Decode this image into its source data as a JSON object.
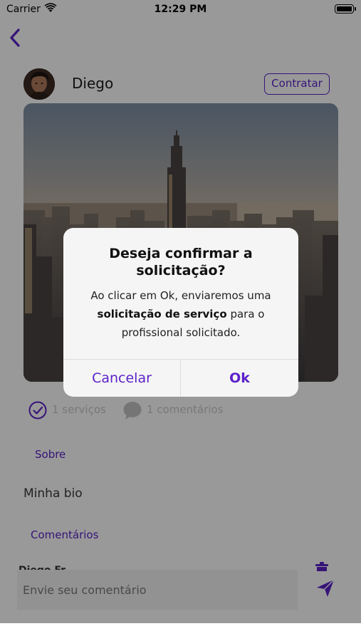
{
  "status_bar": {
    "carrier": "Carrier",
    "time": "12:29 PM"
  },
  "header": {
    "back_icon": "chevron-left-icon"
  },
  "profile": {
    "name": "Diego",
    "hire_button": "Contratar",
    "services": "1 serviços",
    "comments": "1 comentários"
  },
  "tabs": {
    "about": "Sobre",
    "comments": "Comentários"
  },
  "bio": "Minha bio",
  "comment_preview": {
    "author": "Diego Fr"
  },
  "comment_box": {
    "placeholder": "Envie seu comentário",
    "send_icon": "send-icon"
  },
  "dialog": {
    "title": "Deseja confirmar a solicitação?",
    "message_before": "Ao clicar em Ok, enviaremos uma",
    "message_bold": "solicitação de serviço",
    "message_after": "para o profissional solicitado.",
    "cancel": "Cancelar",
    "ok": "Ok"
  },
  "colors": {
    "accent": "#5b21c9",
    "overlay": "rgba(0,0,0,0.40)",
    "dialog_bg": "#f5f5f5"
  }
}
